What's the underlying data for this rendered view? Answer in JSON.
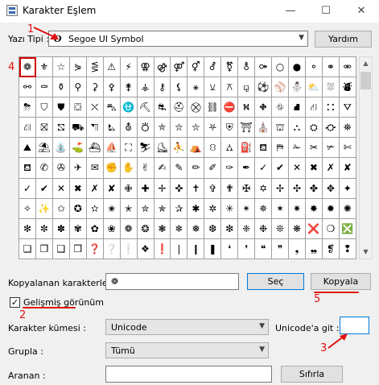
{
  "window": {
    "title": "Karakter Eşlem",
    "minimize": "—",
    "maximize": "☐",
    "close": "✕"
  },
  "font": {
    "label": "Yazı Tipi :",
    "glyph": "O",
    "value": "Segoe UI Symbol",
    "help_button": "Yardım"
  },
  "grid": {
    "rows": [
      [
        "❁",
        "⚜",
        "☆",
        "⋟",
        "⋚",
        "⚠",
        "⚡",
        "⚢",
        "⚣",
        "⚤",
        "⚥",
        "⚦",
        "⚧",
        "⚨",
        "⚩",
        "○",
        "●",
        "⚬",
        "⚭",
        "⚮"
      ],
      [
        "⚯",
        "⚰",
        "⚱",
        "⚲",
        "⚳",
        "⚴",
        "⚵",
        "⚶",
        "⚷",
        "⚸",
        "⚹",
        "⚺",
        "⚻",
        "⚼",
        "⚽",
        "⚾",
        "⛄",
        "⛅",
        "⛆",
        "⛇"
      ],
      [
        "⛈",
        "⛉",
        "⛊",
        "⛋",
        "⛌",
        "⛍",
        "⛎",
        "⛏",
        "⛐",
        "⛑",
        "⛒",
        "⛓",
        "⛔",
        "⛕",
        "⛖",
        "⛗",
        "⛘",
        "⛙",
        "⛚",
        "⛛"
      ],
      [
        "⛜",
        "⛝",
        "⛞",
        "⛟",
        "⛠",
        "⛡",
        "⛢",
        "⛣",
        "⛤",
        "⛥",
        "⛦",
        "⛧",
        "⛨",
        "⛩",
        "⛪",
        "⛫",
        "⛬",
        "⛭",
        "⛮",
        "⛯"
      ],
      [
        "⛰",
        "⛱",
        "⛲",
        "⛳",
        "⛴",
        "⛵",
        "⛶",
        "⛷",
        "⛸",
        "⛹",
        "⛺",
        "⛻",
        "⛼",
        "⛽",
        "⛾",
        "⛿",
        "✁",
        "✂",
        "✃",
        "✄"
      ],
      [
        "⛾",
        "✆",
        "✇",
        "✈",
        "✉",
        "✊",
        "✋",
        "✌",
        "✍",
        "✎",
        "✏",
        "✐",
        "✑",
        "✒",
        "✓",
        "✔",
        "✕",
        "✖",
        "✗",
        "✘"
      ],
      [
        "✓",
        "✔",
        "✕",
        "✖",
        "✗",
        "✘",
        "✙",
        "✚",
        "✛",
        "✜",
        "✝",
        "✞",
        "✟",
        "✠",
        "✡",
        "✢",
        "✣",
        "✤",
        "✥",
        "✦"
      ],
      [
        "✧",
        "✨",
        "✩",
        "✪",
        "✫",
        "✬",
        "✭",
        "✮",
        "✯",
        "✰",
        "✱",
        "✲",
        "✳",
        "✴",
        "✵",
        "✶",
        "✷",
        "✸",
        "✹",
        "✺"
      ],
      [
        "✻",
        "✼",
        "✽",
        "✾",
        "✿",
        "❀",
        "❁",
        "❂",
        "❃",
        "❄",
        "❅",
        "❆",
        "❇",
        "❈",
        "❉",
        "❊",
        "❋",
        "❌",
        "❍",
        "❎"
      ],
      [
        "❏",
        "❐",
        "❑",
        "❒",
        "❓",
        "❔",
        "❕",
        "❖",
        "❗",
        "❘",
        "❙",
        "❚",
        "❛",
        "❜",
        "❝",
        "❞",
        "❟",
        "❠",
        "❡",
        "❢"
      ]
    ]
  },
  "copy": {
    "label": "Kopyalanan karakterler :",
    "value": "❁",
    "select_button": "Seç",
    "copy_button": "Kopyala"
  },
  "advanced": {
    "label": "Gelişmiş görünüm",
    "checked": "✓"
  },
  "charset": {
    "label": "Karakter kümesi :",
    "value": "Unicode"
  },
  "goto": {
    "label": "Unicode'a git :",
    "value": ""
  },
  "group": {
    "label": "Grupla :",
    "value": "Tümü"
  },
  "search": {
    "label": "Aranan :",
    "value": "",
    "reset_button": "Sıfırla"
  },
  "annotations": {
    "n1": "1",
    "n2": "2",
    "n3": "3",
    "n4": "4",
    "n5": "5",
    "color": "#e01010"
  }
}
